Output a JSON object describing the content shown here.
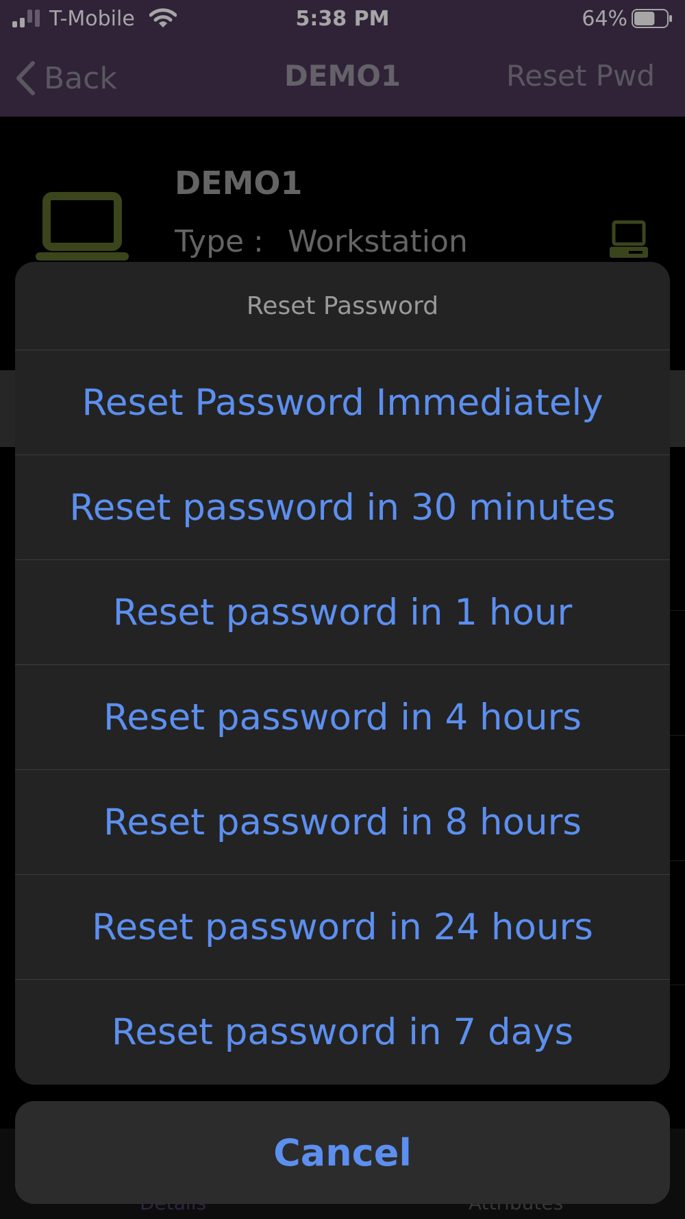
{
  "status_bar": {
    "carrier": "T-Mobile",
    "time": "5:38 PM",
    "battery_percent": "64%",
    "battery_level": 0.64
  },
  "nav": {
    "back_label": "Back",
    "title": "DEMO1",
    "action_label": "Reset Pwd"
  },
  "device": {
    "name": "DEMO1",
    "type_label": "Type :",
    "type_value": "Workstation",
    "icon_color": "#5b6b2b"
  },
  "tabs": {
    "details": "Details",
    "attributes": "Attributes"
  },
  "action_sheet": {
    "title": "Reset Password",
    "options": [
      "Reset Password Immediately",
      "Reset password in 30 minutes",
      "Reset password in 1 hour",
      "Reset password in 4 hours",
      "Reset password in 8 hours",
      "Reset password in 24 hours",
      "Reset password in 7 days"
    ],
    "cancel_label": "Cancel",
    "accent_color": "#5c8fef"
  }
}
